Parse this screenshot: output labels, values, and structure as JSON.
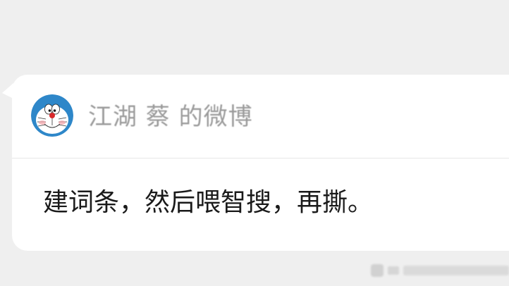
{
  "share_card": {
    "avatar_icon": "doraemon-avatar-icon",
    "source_name": "江湖 蔡 的微博",
    "message": "建词条，然后喂智搜，再撕。"
  },
  "colors": {
    "background": "#efefef",
    "bubble": "#ffffff",
    "source_text": "#9b9b9b",
    "message_text": "#1a1a1a",
    "divider": "#e6e6e6"
  }
}
